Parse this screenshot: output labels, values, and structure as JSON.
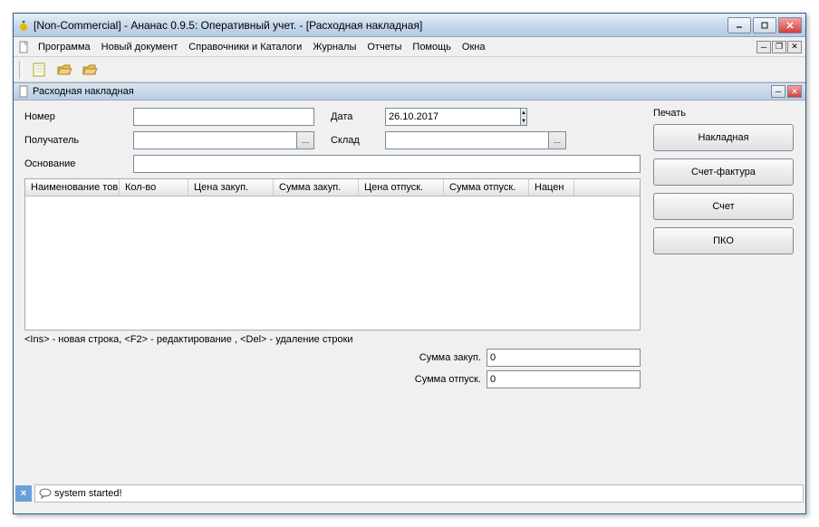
{
  "window": {
    "title": "[Non-Commercial] - Ананас 0.9.5: Оперативный учет. - [Расходная накладная]"
  },
  "menu": {
    "items": [
      "Программа",
      "Новый документ",
      "Справочники и Каталоги",
      "Журналы",
      "Отчеты",
      "Помощь",
      "Окна"
    ]
  },
  "subwindow": {
    "title": "Расходная накладная"
  },
  "form": {
    "number_label": "Номер",
    "number_value": "",
    "date_label": "Дата",
    "date_value": "26.10.2017",
    "recipient_label": "Получатель",
    "recipient_value": "",
    "warehouse_label": "Склад",
    "warehouse_value": "",
    "basis_label": "Основание",
    "basis_value": ""
  },
  "table": {
    "headers": [
      "Наименование тов",
      "Кол-во",
      "Цена закуп.",
      "Сумма закуп.",
      "Цена отпуск.",
      "Сумма отпуск.",
      "Нацен"
    ]
  },
  "hint": "<Ins> - новая строка, <F2> - редактирование , <Del> - удаление строки",
  "totals": {
    "sum_purchase_label": "Сумма закуп.",
    "sum_purchase_value": "0",
    "sum_sale_label": "Сумма отпуск.",
    "sum_sale_value": "0"
  },
  "side": {
    "title": "Печать",
    "buttons": [
      "Накладная",
      "Счет-фактура",
      "Счет",
      "ПКО"
    ]
  },
  "status": {
    "message": "system started!"
  }
}
